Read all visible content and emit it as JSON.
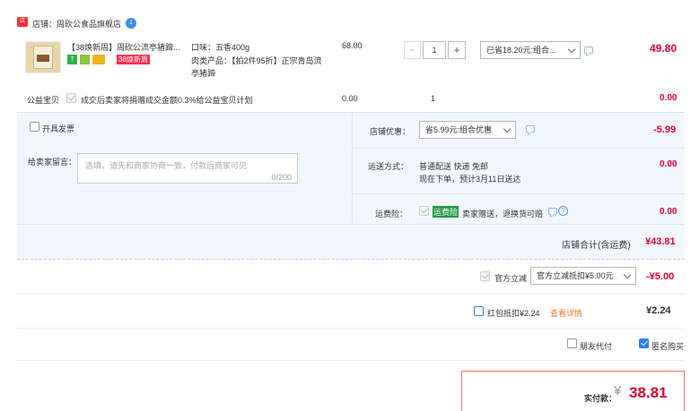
{
  "shop": {
    "label": "店铺：",
    "name": "周砍公食品旗舰店",
    "badge": "1"
  },
  "item": {
    "title": "【38焕新周】周砍公流亭猪蹄...",
    "tag_38": "38焕新周",
    "spec_taste": "口味：五香400g",
    "spec_product": "肉类产品：【拍2件95折】正宗青岛流亭猪蹄",
    "price": "68.00",
    "qty": "1",
    "discount_select": "已省18.20元:组合...",
    "subtotal": "49.80",
    "minus": "−",
    "plus": "+"
  },
  "charity": {
    "label": "公益宝贝",
    "text": "成交后卖家将捐赠成交金额0.3%给公益宝贝计划",
    "price": "0.00",
    "qty": "1",
    "amount": "0.00"
  },
  "invoice": {
    "label": "开具发票"
  },
  "message": {
    "label": "给卖家留言：",
    "placeholder": "选填，请先和商家协商一致，付款后商家可见",
    "counter": "0/200"
  },
  "shop_discount": {
    "label": "店铺优惠：",
    "select": "省5.99元:组合优惠",
    "amount": "-5.99"
  },
  "shipping": {
    "label": "运送方式：",
    "method": "普通配送 快递 免邮",
    "note": "现在下单，预计3月11日送达",
    "amount": "0.00"
  },
  "insurance": {
    "label": "运费险：",
    "badge": "运费险",
    "text": "卖家赠送，退换货可赔",
    "amount": "0.00"
  },
  "shop_total": {
    "label": "店铺合计(含运费)",
    "amount": "¥43.81"
  },
  "official": {
    "label": "官方立减",
    "select": "官方立减抵扣¥5.00元",
    "amount": "-¥5.00"
  },
  "redpacket": {
    "label": "红包抵扣¥2.24",
    "link": "查看详情",
    "amount": "¥2.24"
  },
  "options": {
    "friend_pay": "朋友代付",
    "anonymous": "匿名购买"
  },
  "pay": {
    "label": "实付款：",
    "currency": "¥",
    "amount": "38.81"
  },
  "colors": {
    "accent": "#e4002b",
    "blue": "#2d7cf6",
    "panel": "#f2f7ff"
  }
}
